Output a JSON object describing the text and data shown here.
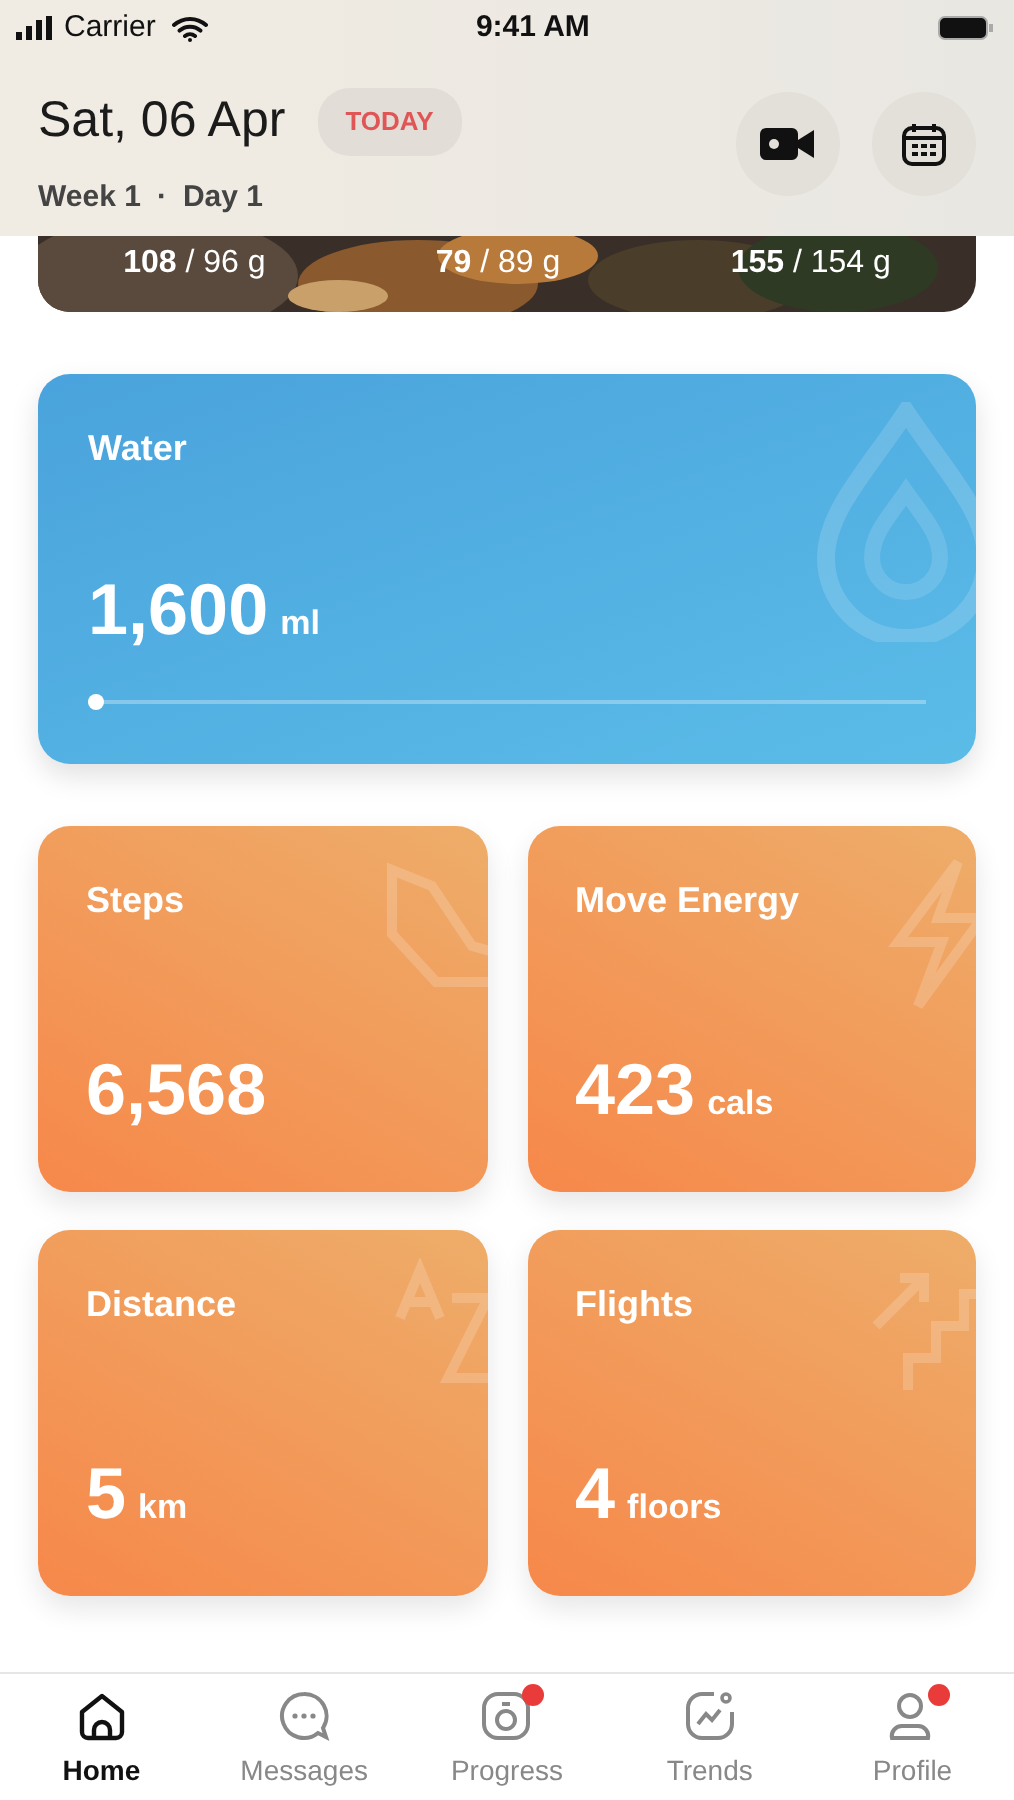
{
  "status_bar": {
    "carrier": "Carrier",
    "time": "9:41 AM"
  },
  "header": {
    "date": "Sat, 06 Apr",
    "badge": "TODAY",
    "subtitle_week": "Week 1",
    "subtitle_separator": "·",
    "subtitle_day": "Day 1"
  },
  "meal_card": {
    "macros": [
      "**108** / 96 g",
      "**79** / 89 g",
      "**155** / 154 g"
    ]
  },
  "water": {
    "label": "Water",
    "value": "1,600",
    "unit": "ml",
    "level": 0
  },
  "metrics": [
    {
      "label": "Steps",
      "value": "6,568"
    },
    {
      "label": "Move Energy",
      "value": "423",
      "unit": "cals"
    },
    {
      "label": "Distance",
      "value": "5",
      "unit": "km"
    },
    {
      "label": "Flights",
      "value": "4",
      "unit": "floors"
    }
  ],
  "tab_bar": [
    {
      "label": "Home",
      "selected": true,
      "notification": false
    },
    {
      "label": "Messages",
      "selected": false,
      "notification": false
    },
    {
      "label": "Progress",
      "selected": false,
      "notification": true
    },
    {
      "label": "Trends",
      "selected": false,
      "notification": false
    },
    {
      "label": "Profile",
      "selected": false,
      "notification": true
    }
  ]
}
